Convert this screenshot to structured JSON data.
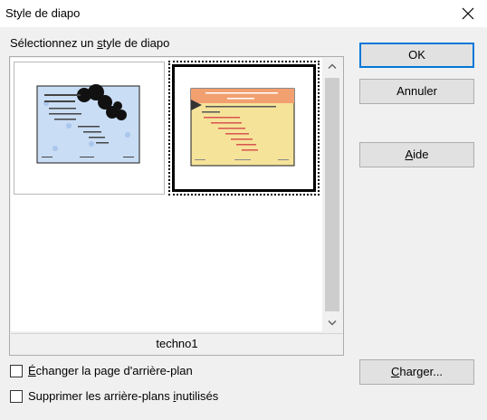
{
  "window": {
    "title": "Style de diapo",
    "close_icon": "close-icon"
  },
  "chooser": {
    "label_before": "Sélectionnez un ",
    "label_access": "s",
    "label_after": "tyle de diapo",
    "selected_name": "techno1",
    "thumbnails": [
      {
        "name": "blue-style-thumbnail",
        "selected": false
      },
      {
        "name": "techno1-thumbnail",
        "selected": true
      }
    ],
    "scroll_up_icon": "chevron-up-icon",
    "scroll_down_icon": "chevron-down-icon"
  },
  "buttons": {
    "ok": "OK",
    "cancel": "Annuler",
    "help_access": "A",
    "help_rest": "ide",
    "load_access": "C",
    "load_rest": "harger..."
  },
  "options": {
    "exchange_access": "É",
    "exchange_rest": "changer la page d'arrière-plan",
    "exchange_checked": false,
    "delete_before": "Supprimer les arrière-plans ",
    "delete_access": "i",
    "delete_after": "nutilisés",
    "delete_checked": false
  },
  "colors": {
    "accent": "#0078d7",
    "blue_slide": "#c9ddf5",
    "orange_header": "#f2a070",
    "yellow_body": "#f5e39a"
  }
}
